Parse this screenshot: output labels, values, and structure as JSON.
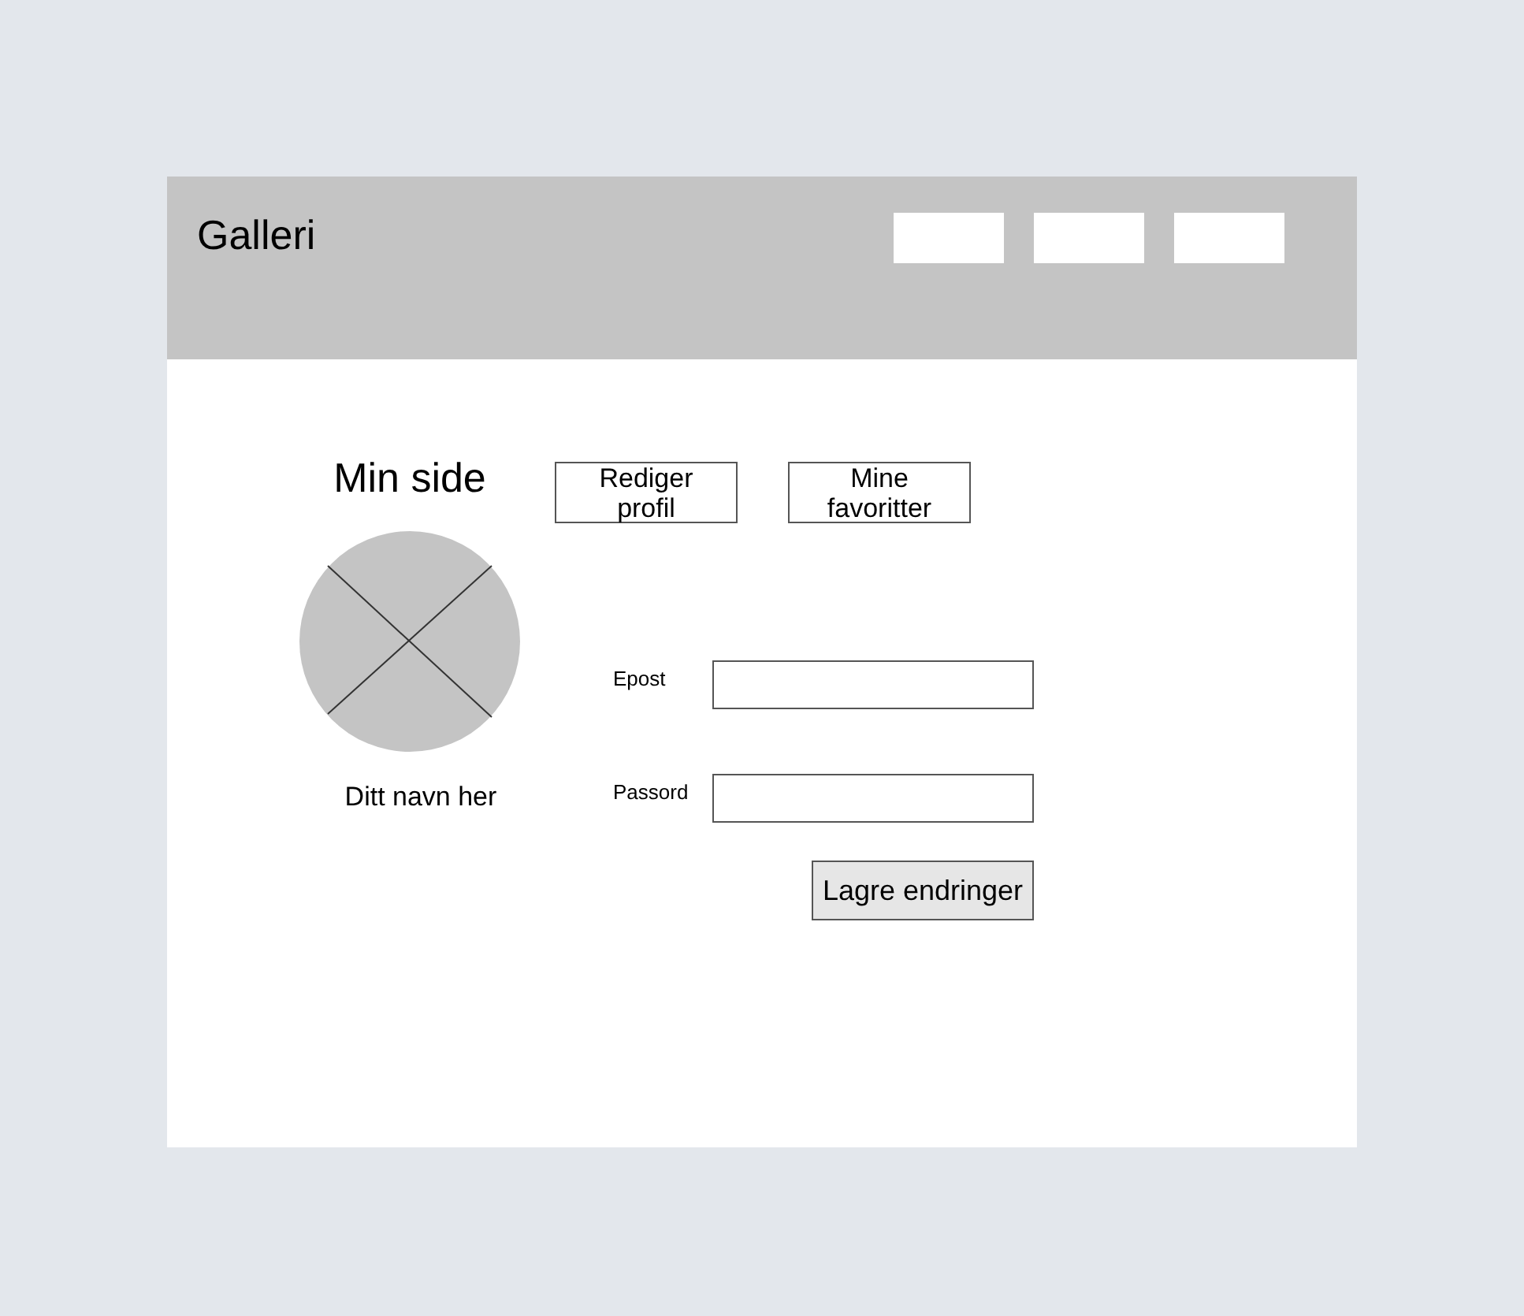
{
  "header": {
    "title": "Galleri"
  },
  "page_title": "Min side",
  "tabs": [
    {
      "label": "Rediger profil"
    },
    {
      "label": "Mine favoritter"
    }
  ],
  "profile": {
    "name": "Ditt navn her"
  },
  "form": {
    "fields": [
      {
        "label": "Epost"
      },
      {
        "label": "Passord"
      }
    ],
    "submit": "Lagre endringer"
  }
}
